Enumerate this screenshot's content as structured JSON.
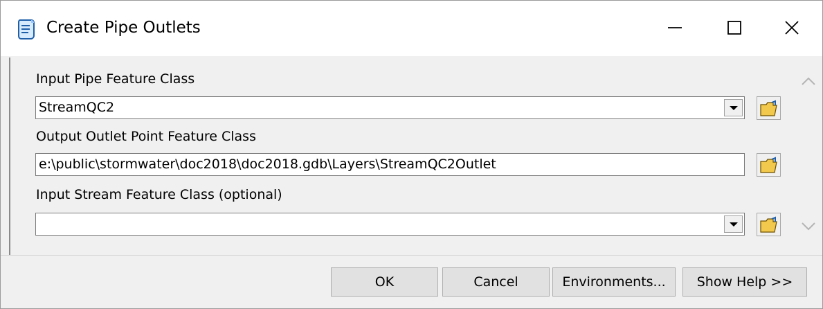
{
  "window": {
    "title": "Create Pipe Outlets",
    "app_icon": "scroll-tool-icon",
    "controls": [
      "minimize-icon",
      "maximize-icon",
      "close-icon"
    ]
  },
  "form": {
    "fields": [
      {
        "label": "Input Pipe Feature Class",
        "value": "StreamQC2",
        "type": "combo"
      },
      {
        "label": "Output Outlet Point Feature Class",
        "value": "e:\\public\\stormwater\\doc2018\\doc2018.gdb\\Layers\\StreamQC2Outlet",
        "type": "text"
      },
      {
        "label": "Input Stream Feature Class (optional)",
        "value": "",
        "type": "combo"
      }
    ]
  },
  "buttons": {
    "ok": "OK",
    "cancel": "Cancel",
    "environments": "Environments...",
    "show_help": "Show Help >>"
  },
  "colors": {
    "background": "#f0f0f0",
    "titlebar": "#ffffff",
    "folder_yellow": "#f2c94c"
  }
}
